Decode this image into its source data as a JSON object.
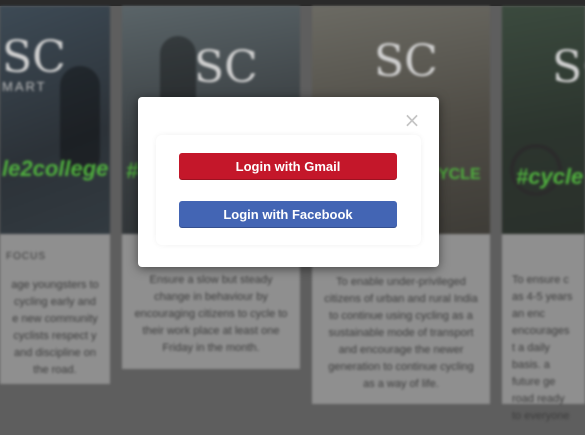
{
  "background": {
    "cards": [
      {
        "logo_letters": "SC",
        "logo_sub": "MART",
        "tag": "le2college",
        "heading": "FOCUS",
        "text": "age youngsters to cycling early and e new community cyclists respect y and discipline on the road."
      },
      {
        "logo_letters": "SC",
        "logo_sub": "",
        "tag": "#c",
        "heading": "",
        "text": "Ensure a slow but steady change in behaviour by encouraging citizens to cycle to their work place at least one Friday in the month."
      },
      {
        "logo_letters": "SC",
        "logo_sub": "",
        "tag": "YCLE",
        "heading": "",
        "text": "To enable under-privileged citizens of urban and rural India to continue using cycling as a sustainable mode of transport and encourage the newer generation to continue cycling as a way of life."
      },
      {
        "logo_letters": "SC",
        "logo_sub": "",
        "tag": "#cycle",
        "heading": "",
        "text": "To ensure c as 4-5 years an enc encourages t a daily basis. a future ge road ready to everyone"
      }
    ]
  },
  "modal": {
    "close_symbol": "×",
    "gmail_label": "Login with Gmail",
    "facebook_label": "Login with Facebook"
  },
  "colors": {
    "gmail": "#c4172a",
    "facebook": "#4365b4"
  }
}
